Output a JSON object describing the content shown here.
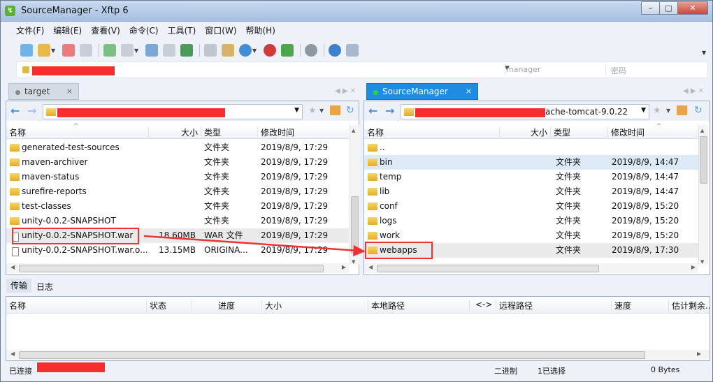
{
  "window": {
    "title": "SourceManager   - Xftp 6",
    "app_icon": "xftp-icon",
    "min": "–",
    "max": "□",
    "close": "✕"
  },
  "menu": [
    "文件(F)",
    "编辑(E)",
    "查看(V)",
    "命令(C)",
    "工具(T)",
    "窗口(W)",
    "帮助(H)"
  ],
  "address": {
    "user_placeholder": "manager",
    "password_placeholder": "密码"
  },
  "tabs": {
    "left": {
      "label": "target",
      "close": "×"
    },
    "right": {
      "label": "SourceManager",
      "close": "×"
    }
  },
  "left": {
    "headers": {
      "name": "名称",
      "size": "大小",
      "type": "类型",
      "modified": "修改时间"
    },
    "rows": [
      {
        "name": "generated-test-sources",
        "size": "",
        "type": "文件夹",
        "modified": "2019/8/9, 17:29"
      },
      {
        "name": "maven-archiver",
        "size": "",
        "type": "文件夹",
        "modified": "2019/8/9, 17:29"
      },
      {
        "name": "maven-status",
        "size": "",
        "type": "文件夹",
        "modified": "2019/8/9, 17:29"
      },
      {
        "name": "surefire-reports",
        "size": "",
        "type": "文件夹",
        "modified": "2019/8/9, 17:29"
      },
      {
        "name": "test-classes",
        "size": "",
        "type": "文件夹",
        "modified": "2019/8/9, 17:29"
      },
      {
        "name": "unity-0.0.2-SNAPSHOT",
        "size": "",
        "type": "文件夹",
        "modified": "2019/8/9, 17:29"
      },
      {
        "name": "unity-0.0.2-SNAPSHOT.war",
        "size": "18.60MB",
        "type": "WAR 文件",
        "modified": "2019/8/9, 17:29"
      },
      {
        "name": "unity-0.0.2-SNAPSHOT.war.o...",
        "size": "13.15MB",
        "type": "ORIGINA...",
        "modified": "2019/8/9, 17:29"
      }
    ]
  },
  "right": {
    "path_suffix": "ache-tomcat-9.0.22",
    "headers": {
      "name": "名称",
      "size": "大小",
      "type": "类型",
      "modified": "修改时间"
    },
    "rows": [
      {
        "name": "..",
        "size": "",
        "type": "",
        "modified": ""
      },
      {
        "name": "bin",
        "size": "",
        "type": "文件夹",
        "modified": "2019/8/9, 14:47"
      },
      {
        "name": "temp",
        "size": "",
        "type": "文件夹",
        "modified": "2019/8/9, 14:47"
      },
      {
        "name": "lib",
        "size": "",
        "type": "文件夹",
        "modified": "2019/8/9, 14:47"
      },
      {
        "name": "conf",
        "size": "",
        "type": "文件夹",
        "modified": "2019/8/9, 15:20"
      },
      {
        "name": "logs",
        "size": "",
        "type": "文件夹",
        "modified": "2019/8/9, 15:20"
      },
      {
        "name": "work",
        "size": "",
        "type": "文件夹",
        "modified": "2019/8/9, 15:20"
      },
      {
        "name": "webapps",
        "size": "",
        "type": "文件夹",
        "modified": "2019/8/9, 17:30"
      }
    ]
  },
  "bottom": {
    "tabs": [
      "传输",
      "日志"
    ],
    "headers": [
      "名称",
      "状态",
      "进度",
      "大小",
      "本地路径",
      "<->",
      "远程路径",
      "速度",
      "估计剩余..."
    ]
  },
  "status": {
    "connected": "已连接",
    "mode": "二进制",
    "selected": "1已选择",
    "bytes": "0 Bytes"
  },
  "colors": {
    "tab_active": "#1e8ce0",
    "annotation": "#e33333",
    "redaction": "#f52d2d"
  }
}
